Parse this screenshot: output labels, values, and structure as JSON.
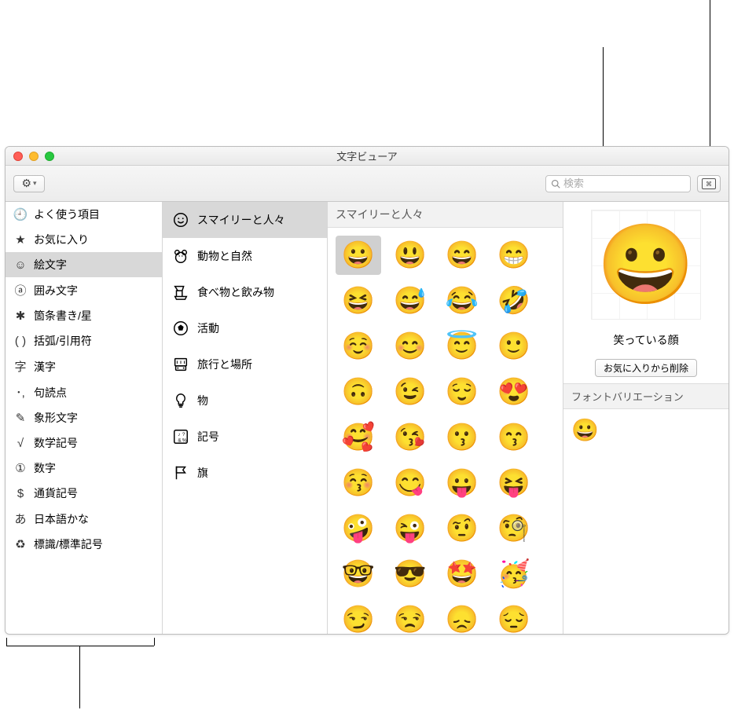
{
  "window": {
    "title": "文字ビューア"
  },
  "search": {
    "placeholder": "検索"
  },
  "sidebar": {
    "items": [
      {
        "icon": "🕘",
        "label": "よく使う項目"
      },
      {
        "icon": "★",
        "label": "お気に入り"
      },
      {
        "icon": "☺",
        "label": "絵文字",
        "selected": true
      },
      {
        "icon": "ⓐ",
        "label": "囲み文字"
      },
      {
        "icon": "✱",
        "label": "箇条書き/星"
      },
      {
        "icon": "( )",
        "label": "括弧/引用符"
      },
      {
        "icon": "字",
        "label": "漢字"
      },
      {
        "icon": "･,",
        "label": "句読点"
      },
      {
        "icon": "✎",
        "label": "象形文字"
      },
      {
        "icon": "√",
        "label": "数学記号"
      },
      {
        "icon": "①",
        "label": "数字"
      },
      {
        "icon": "$",
        "label": "通貨記号"
      },
      {
        "icon": "あ",
        "label": "日本語かな"
      },
      {
        "icon": "♻",
        "label": "標識/標準記号"
      }
    ]
  },
  "subcategories": [
    {
      "icon": "smiley",
      "label": "スマイリーと人々",
      "selected": true
    },
    {
      "icon": "bear",
      "label": "動物と自然"
    },
    {
      "icon": "food",
      "label": "食べ物と飲み物"
    },
    {
      "icon": "ball",
      "label": "活動"
    },
    {
      "icon": "car",
      "label": "旅行と場所"
    },
    {
      "icon": "bulb",
      "label": "物"
    },
    {
      "icon": "symbols",
      "label": "記号"
    },
    {
      "icon": "flag",
      "label": "旗"
    }
  ],
  "grid": {
    "header": "スマイリーと人々",
    "selected_index": 0,
    "emoji": [
      "😀",
      "😃",
      "😄",
      "😁",
      "😆",
      "😅",
      "😂",
      "🤣",
      "☺️",
      "😊",
      "😇",
      "🙂",
      "🙃",
      "😉",
      "😌",
      "😍",
      "🥰",
      "😘",
      "😗",
      "😙",
      "😚",
      "😋",
      "😛",
      "😝",
      "🤪",
      "😜",
      "🤨",
      "🧐",
      "🤓",
      "😎",
      "🤩",
      "🥳",
      "😏",
      "😒",
      "😞",
      "😔"
    ]
  },
  "detail": {
    "preview": "😀",
    "name": "笑っている顔",
    "favorite_button": "お気に入りから削除",
    "variation_header": "フォントバリエーション",
    "variation_emoji": "😀"
  }
}
